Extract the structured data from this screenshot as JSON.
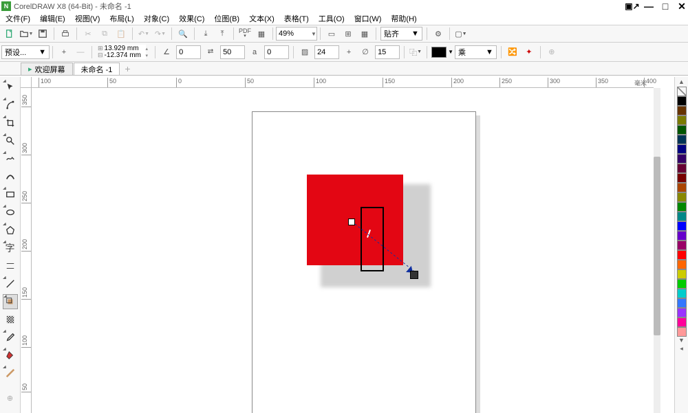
{
  "title": "CorelDRAW X8 (64-Bit) - 未命名 -1",
  "menu": [
    "文件(F)",
    "编辑(E)",
    "视图(V)",
    "布局(L)",
    "对象(C)",
    "效果(C)",
    "位图(B)",
    "文本(X)",
    "表格(T)",
    "工具(O)",
    "窗口(W)",
    "帮助(H)"
  ],
  "toolbar": {
    "zoom": "49%",
    "snap": "贴齐"
  },
  "propbar": {
    "preset": "预设...",
    "x": "13.929 mm",
    "y": "-12.374 mm",
    "angle": "0",
    "copies": "50",
    "a_val": "0",
    "blur": "24",
    "feather": "15",
    "blend": "乘"
  },
  "tabs": {
    "welcome": "欢迎屏幕",
    "doc": "未命名 -1"
  },
  "ruler_h": [
    {
      "p": 10,
      "l": "100"
    },
    {
      "p": 110,
      "l": "50"
    },
    {
      "p": 210,
      "l": "0"
    },
    {
      "p": 310,
      "l": "50"
    },
    {
      "p": 410,
      "l": "100"
    },
    {
      "p": 510,
      "l": "150"
    },
    {
      "p": 610,
      "l": "200"
    },
    {
      "p": 680,
      "l": "250"
    },
    {
      "p": 750,
      "l": "300"
    },
    {
      "p": 820,
      "l": "350"
    },
    {
      "p": 890,
      "l": "400"
    }
  ],
  "ruler_v": [
    {
      "p": 10,
      "l": "350"
    },
    {
      "p": 80,
      "l": "300"
    },
    {
      "p": 150,
      "l": "250"
    },
    {
      "p": 220,
      "l": "200"
    },
    {
      "p": 290,
      "l": "150"
    },
    {
      "p": 360,
      "l": "100"
    },
    {
      "p": 430,
      "l": "50"
    }
  ],
  "ruler_unit": "毫米",
  "palette": [
    "#000000",
    "#663300",
    "#7a7a00",
    "#005500",
    "#003355",
    "#000080",
    "#330066",
    "#660033",
    "#770000",
    "#aa4400",
    "#888800",
    "#008800",
    "#008888",
    "#0000ff",
    "#6600cc",
    "#990066",
    "#ff0000",
    "#ff6600",
    "#cccc00",
    "#00cc00",
    "#00cccc",
    "#3377ff",
    "#9933ff",
    "#ff0099",
    "#ff9999"
  ]
}
